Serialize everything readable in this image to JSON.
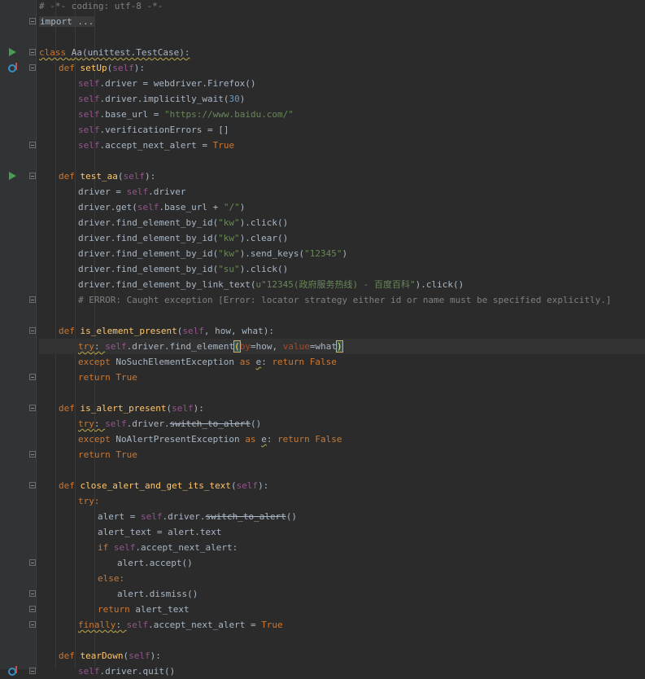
{
  "editor": {
    "lines": [
      {
        "indent": 0,
        "tokens": [
          {
            "t": "# -*- coding: utf-8 -*-",
            "c": "cm"
          }
        ]
      },
      {
        "indent": 0,
        "tokens": [
          {
            "t": "import ...",
            "c": "fold-text"
          }
        ]
      },
      {
        "indent": 0,
        "tokens": []
      },
      {
        "indent": 0,
        "tokens": [
          {
            "t": "class ",
            "c": "kw wavy"
          },
          {
            "t": "Aa",
            "c": "wavy"
          },
          {
            "t": "(unittest.TestCase):",
            "c": "wavy"
          }
        ]
      },
      {
        "indent": 1,
        "tokens": [
          {
            "t": "def ",
            "c": "kw"
          },
          {
            "t": "setUp",
            "c": "fn"
          },
          {
            "t": "("
          },
          {
            "t": "self",
            "c": "sf"
          },
          {
            "t": "):"
          }
        ]
      },
      {
        "indent": 2,
        "tokens": [
          {
            "t": "self",
            "c": "sf"
          },
          {
            "t": ".driver = webdriver.Firefox()"
          }
        ]
      },
      {
        "indent": 2,
        "tokens": [
          {
            "t": "self",
            "c": "sf"
          },
          {
            "t": ".driver.implicitly_wait("
          },
          {
            "t": "30",
            "c": "nu"
          },
          {
            "t": ")"
          }
        ]
      },
      {
        "indent": 2,
        "tokens": [
          {
            "t": "self",
            "c": "sf"
          },
          {
            "t": ".base_url = "
          },
          {
            "t": "\"https://www.baidu.com/\"",
            "c": "st"
          }
        ]
      },
      {
        "indent": 2,
        "tokens": [
          {
            "t": "self",
            "c": "sf"
          },
          {
            "t": ".verificationErrors = []"
          }
        ]
      },
      {
        "indent": 2,
        "tokens": [
          {
            "t": "self",
            "c": "sf"
          },
          {
            "t": ".accept_next_alert = "
          },
          {
            "t": "True",
            "c": "kw"
          }
        ]
      },
      {
        "indent": 0,
        "tokens": []
      },
      {
        "indent": 1,
        "tokens": [
          {
            "t": "def ",
            "c": "kw"
          },
          {
            "t": "test_aa",
            "c": "fn"
          },
          {
            "t": "("
          },
          {
            "t": "self",
            "c": "sf"
          },
          {
            "t": "):"
          }
        ]
      },
      {
        "indent": 2,
        "tokens": [
          {
            "t": "driver = "
          },
          {
            "t": "self",
            "c": "sf"
          },
          {
            "t": ".driver"
          }
        ]
      },
      {
        "indent": 2,
        "tokens": [
          {
            "t": "driver.get("
          },
          {
            "t": "self",
            "c": "sf"
          },
          {
            "t": ".base_url + "
          },
          {
            "t": "\"/\"",
            "c": "st"
          },
          {
            "t": ")"
          }
        ]
      },
      {
        "indent": 2,
        "tokens": [
          {
            "t": "driver.find_element_by_id("
          },
          {
            "t": "\"kw\"",
            "c": "st"
          },
          {
            "t": ").click()"
          }
        ]
      },
      {
        "indent": 2,
        "tokens": [
          {
            "t": "driver.find_element_by_id("
          },
          {
            "t": "\"kw\"",
            "c": "st"
          },
          {
            "t": ").clear()"
          }
        ]
      },
      {
        "indent": 2,
        "tokens": [
          {
            "t": "driver.find_element_by_id("
          },
          {
            "t": "\"kw\"",
            "c": "st"
          },
          {
            "t": ").send_keys("
          },
          {
            "t": "\"12345\"",
            "c": "st"
          },
          {
            "t": ")"
          }
        ]
      },
      {
        "indent": 2,
        "tokens": [
          {
            "t": "driver.find_element_by_id("
          },
          {
            "t": "\"su\"",
            "c": "st"
          },
          {
            "t": ").click()"
          }
        ]
      },
      {
        "indent": 2,
        "tokens": [
          {
            "t": "driver.find_element_by_link_text("
          },
          {
            "t": "u\"12345(政府服务热线) - 百度百科\"",
            "c": "st"
          },
          {
            "t": ").click()"
          }
        ]
      },
      {
        "indent": 2,
        "tokens": [
          {
            "t": "# ERROR: Caught exception [Error: locator strategy either id or name must be specified explicitly.]",
            "c": "cm"
          }
        ]
      },
      {
        "indent": 0,
        "tokens": []
      },
      {
        "indent": 1,
        "tokens": [
          {
            "t": "def ",
            "c": "kw"
          },
          {
            "t": "is_element_present",
            "c": "fn"
          },
          {
            "t": "("
          },
          {
            "t": "self",
            "c": "sf"
          },
          {
            "t": ", how, what):"
          }
        ]
      },
      {
        "indent": 2,
        "current": true,
        "tokens": [
          {
            "t": "try",
            "c": "kw wavy"
          },
          {
            "t": ": ",
            "c": "wavy"
          },
          {
            "t": "self",
            "c": "sf"
          },
          {
            "t": ".driver.find_element"
          },
          {
            "t": "(",
            "c": "brace"
          },
          {
            "t": "by",
            "c": "pn"
          },
          {
            "t": "=how, "
          },
          {
            "t": "value",
            "c": "pn"
          },
          {
            "t": "=what"
          },
          {
            "t": ")",
            "c": "brace"
          }
        ]
      },
      {
        "indent": 2,
        "tokens": [
          {
            "t": "except ",
            "c": "kw"
          },
          {
            "t": "NoSuchElementException "
          },
          {
            "t": "as ",
            "c": "kw"
          },
          {
            "t": "e",
            "c": "wavy"
          },
          {
            "t": ": "
          },
          {
            "t": "return False",
            "c": "kw"
          }
        ]
      },
      {
        "indent": 2,
        "tokens": [
          {
            "t": "return True",
            "c": "kw"
          }
        ]
      },
      {
        "indent": 0,
        "tokens": []
      },
      {
        "indent": 1,
        "tokens": [
          {
            "t": "def ",
            "c": "kw"
          },
          {
            "t": "is_alert_present",
            "c": "fn"
          },
          {
            "t": "("
          },
          {
            "t": "self",
            "c": "sf"
          },
          {
            "t": "):"
          }
        ]
      },
      {
        "indent": 2,
        "tokens": [
          {
            "t": "try",
            "c": "kw wavy"
          },
          {
            "t": ": ",
            "c": "wavy"
          },
          {
            "t": "self",
            "c": "sf"
          },
          {
            "t": ".driver."
          },
          {
            "t": "switch_to_alert",
            "c": "strike"
          },
          {
            "t": "()"
          }
        ]
      },
      {
        "indent": 2,
        "tokens": [
          {
            "t": "except ",
            "c": "kw"
          },
          {
            "t": "NoAlertPresentException "
          },
          {
            "t": "as ",
            "c": "kw"
          },
          {
            "t": "e",
            "c": "wavy"
          },
          {
            "t": ": "
          },
          {
            "t": "return False",
            "c": "kw"
          }
        ]
      },
      {
        "indent": 2,
        "tokens": [
          {
            "t": "return True",
            "c": "kw"
          }
        ]
      },
      {
        "indent": 0,
        "tokens": []
      },
      {
        "indent": 1,
        "tokens": [
          {
            "t": "def ",
            "c": "kw"
          },
          {
            "t": "close_alert_and_get_its_text",
            "c": "fn"
          },
          {
            "t": "("
          },
          {
            "t": "self",
            "c": "sf"
          },
          {
            "t": "):"
          }
        ]
      },
      {
        "indent": 2,
        "tokens": [
          {
            "t": "try:",
            "c": "kw"
          }
        ]
      },
      {
        "indent": 3,
        "tokens": [
          {
            "t": "alert = "
          },
          {
            "t": "self",
            "c": "sf"
          },
          {
            "t": ".driver."
          },
          {
            "t": "switch_to_alert",
            "c": "strike"
          },
          {
            "t": "()"
          }
        ]
      },
      {
        "indent": 3,
        "tokens": [
          {
            "t": "alert_text = alert.text"
          }
        ]
      },
      {
        "indent": 3,
        "tokens": [
          {
            "t": "if ",
            "c": "kw"
          },
          {
            "t": "self",
            "c": "sf"
          },
          {
            "t": ".accept_next_alert:"
          }
        ]
      },
      {
        "indent": 4,
        "tokens": [
          {
            "t": "alert.accept()"
          }
        ]
      },
      {
        "indent": 3,
        "tokens": [
          {
            "t": "else:",
            "c": "kw"
          }
        ]
      },
      {
        "indent": 4,
        "tokens": [
          {
            "t": "alert.dismiss()"
          }
        ]
      },
      {
        "indent": 3,
        "tokens": [
          {
            "t": "return ",
            "c": "kw"
          },
          {
            "t": "alert_text"
          }
        ]
      },
      {
        "indent": 2,
        "tokens": [
          {
            "t": "finally",
            "c": "kw wavy"
          },
          {
            "t": ": ",
            "c": "wavy"
          },
          {
            "t": "self",
            "c": "sf"
          },
          {
            "t": ".accept_next_alert = "
          },
          {
            "t": "True",
            "c": "kw"
          }
        ]
      },
      {
        "indent": 0,
        "tokens": []
      },
      {
        "indent": 1,
        "tokens": [
          {
            "t": "def ",
            "c": "kw"
          },
          {
            "t": "tearDown",
            "c": "fn"
          },
          {
            "t": "("
          },
          {
            "t": "self",
            "c": "sf"
          },
          {
            "t": "):"
          }
        ]
      },
      {
        "indent": 2,
        "tokens": [
          {
            "t": "self",
            "c": "sf"
          },
          {
            "t": ".driver.quit()"
          }
        ]
      }
    ]
  },
  "gutter": {
    "run_markers": [
      3,
      11
    ],
    "override_markers": [
      4,
      43
    ],
    "fold_open": [
      1,
      3,
      4,
      11,
      21,
      26,
      31,
      43
    ],
    "fold_close": [
      9,
      19,
      24,
      29,
      36,
      38,
      39,
      40
    ]
  },
  "colors": {
    "background": "#2b2b2b",
    "gutter": "#313335",
    "keyword": "#cc7832",
    "string": "#6a8759",
    "number": "#6897bb",
    "function": "#ffc66d",
    "self": "#94558d",
    "comment": "#808080",
    "param": "#aa4926"
  }
}
